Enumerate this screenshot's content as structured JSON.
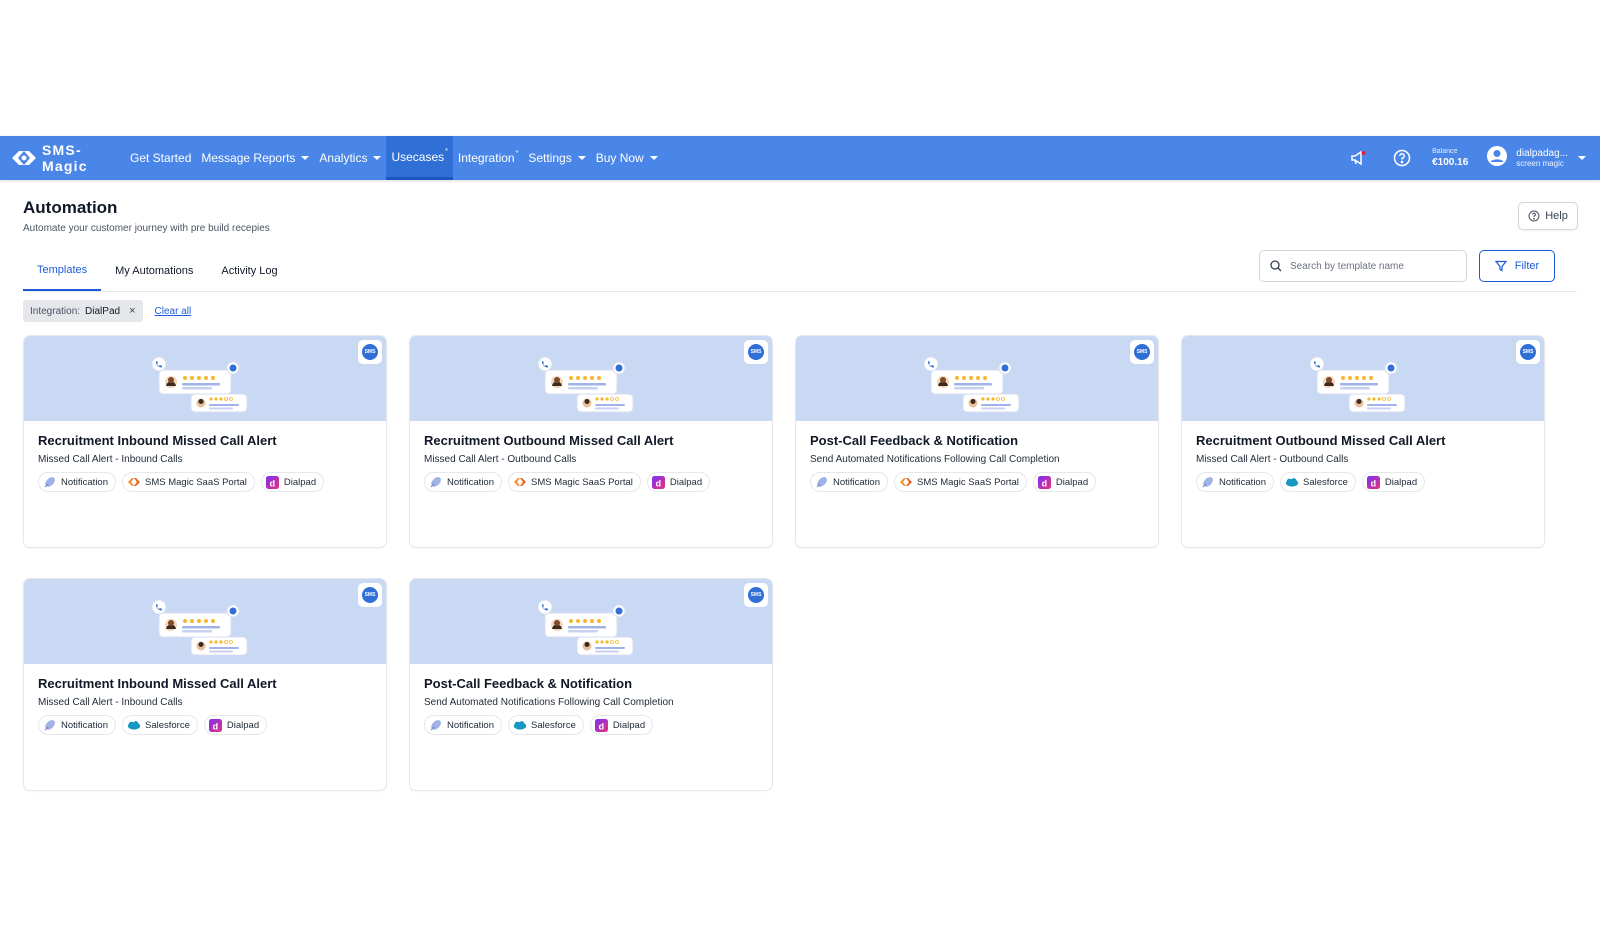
{
  "nav": {
    "brand": "SMS-Magic",
    "items": [
      {
        "label": "Get Started",
        "caret": false,
        "sup": ""
      },
      {
        "label": "Message Reports",
        "caret": true,
        "sup": ""
      },
      {
        "label": "Analytics",
        "caret": true,
        "sup": ""
      },
      {
        "label": "Usecases",
        "caret": false,
        "sup": "*"
      },
      {
        "label": "Integration",
        "caret": false,
        "sup": "*"
      },
      {
        "label": "Settings",
        "caret": true,
        "sup": ""
      },
      {
        "label": "Buy Now",
        "caret": true,
        "sup": ""
      }
    ],
    "active_index": 3,
    "balance_label": "Balance",
    "balance_value": "€100.16",
    "user_name": "dialpadag...",
    "user_org": "screen magic"
  },
  "page": {
    "title": "Automation",
    "subtitle": "Automate your customer journey with pre build recepies",
    "help_label": "Help"
  },
  "tabs": [
    {
      "label": "Templates",
      "active": true
    },
    {
      "label": "My Automations",
      "active": false
    },
    {
      "label": "Activity Log",
      "active": false
    }
  ],
  "search": {
    "placeholder": "Search by template name"
  },
  "filter_label": "Filter",
  "active_filter": {
    "key": "Integration:",
    "value": "DialPad",
    "close": "×"
  },
  "clear_all": "Clear all",
  "sms_badge": "SMS",
  "colors": {
    "accent": "#1e5ad6",
    "navbar": "#4a86e8",
    "hero": "#c9d8f3"
  },
  "cards": [
    {
      "title": "Recruitment Inbound Missed Call Alert",
      "subtitle": "Missed Call Alert - Inbound Calls",
      "tags": [
        {
          "label": "Notification",
          "icon": "notification-icon"
        },
        {
          "label": "SMS Magic SaaS Portal",
          "icon": "sms-magic-icon"
        },
        {
          "label": "Dialpad",
          "icon": "dialpad-icon"
        }
      ]
    },
    {
      "title": "Recruitment Outbound Missed Call Alert",
      "subtitle": "Missed Call Alert - Outbound Calls",
      "tags": [
        {
          "label": "Notification",
          "icon": "notification-icon"
        },
        {
          "label": "SMS Magic SaaS Portal",
          "icon": "sms-magic-icon"
        },
        {
          "label": "Dialpad",
          "icon": "dialpad-icon"
        }
      ]
    },
    {
      "title": "Post-Call Feedback & Notification",
      "subtitle": "Send Automated Notifications Following Call Completion",
      "tags": [
        {
          "label": "Notification",
          "icon": "notification-icon"
        },
        {
          "label": "SMS Magic SaaS Portal",
          "icon": "sms-magic-icon"
        },
        {
          "label": "Dialpad",
          "icon": "dialpad-icon"
        }
      ]
    },
    {
      "title": "Recruitment Outbound Missed Call Alert",
      "subtitle": "Missed Call Alert - Outbound Calls",
      "tags": [
        {
          "label": "Notification",
          "icon": "notification-icon"
        },
        {
          "label": "Salesforce",
          "icon": "salesforce-icon"
        },
        {
          "label": "Dialpad",
          "icon": "dialpad-icon"
        }
      ]
    },
    {
      "title": "Recruitment Inbound Missed Call Alert",
      "subtitle": "Missed Call Alert - Inbound Calls",
      "tags": [
        {
          "label": "Notification",
          "icon": "notification-icon"
        },
        {
          "label": "Salesforce",
          "icon": "salesforce-icon"
        },
        {
          "label": "Dialpad",
          "icon": "dialpad-icon"
        }
      ]
    },
    {
      "title": "Post-Call Feedback & Notification",
      "subtitle": "Send Automated Notifications Following Call Completion",
      "tags": [
        {
          "label": "Notification",
          "icon": "notification-icon"
        },
        {
          "label": "Salesforce",
          "icon": "salesforce-icon"
        },
        {
          "label": "Dialpad",
          "icon": "dialpad-icon"
        }
      ]
    }
  ]
}
